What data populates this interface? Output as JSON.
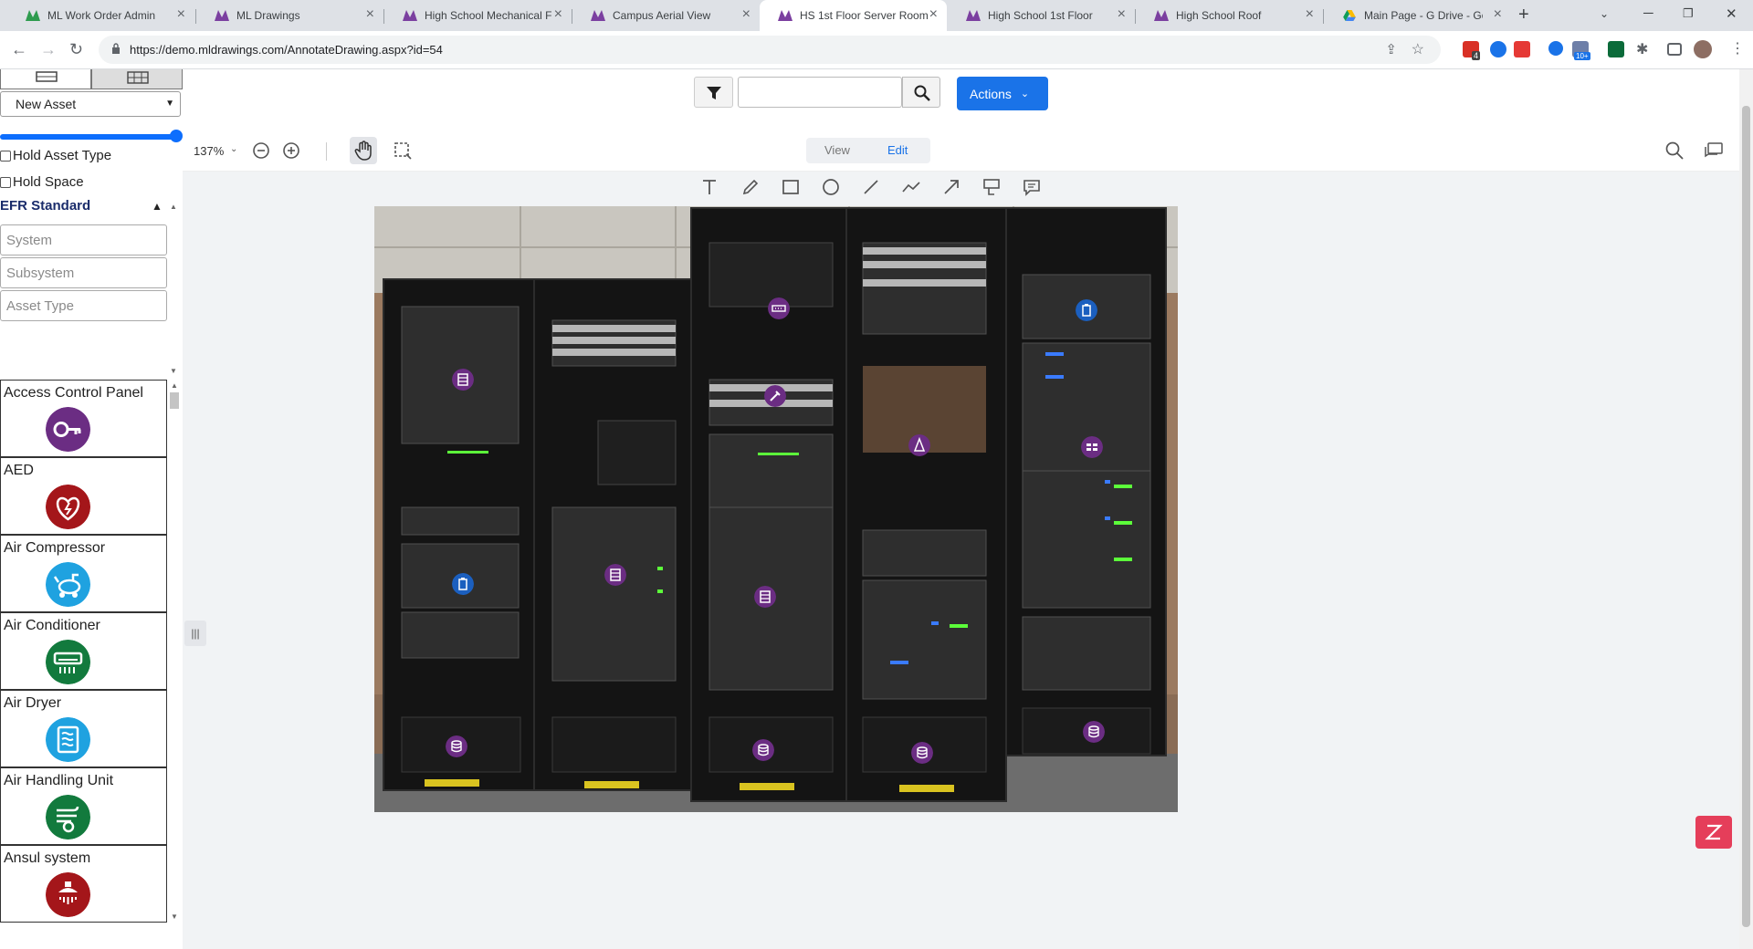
{
  "browser": {
    "tabs": [
      {
        "title": "ML Work Order Admin",
        "favicon": "ml-green-logo"
      },
      {
        "title": "ML Drawings",
        "favicon": "ml-purple-logo"
      },
      {
        "title": "High School Mechanical F",
        "favicon": "ml-purple-logo"
      },
      {
        "title": "Campus Aerial View",
        "favicon": "ml-purple-logo"
      },
      {
        "title": "HS 1st Floor Server Room",
        "favicon": "ml-purple-logo"
      },
      {
        "title": "High School 1st Floor",
        "favicon": "ml-purple-logo"
      },
      {
        "title": "High School Roof",
        "favicon": "ml-purple-logo"
      },
      {
        "title": "Main Page - G Drive - Goo",
        "favicon": "google-drive-logo"
      }
    ],
    "active_tab": 4,
    "new_tab": "+",
    "url": "https://demo.mldrawings.com/AnnotateDrawing.aspx?id=54",
    "ext_badges": {
      "b1": "4",
      "b2": "10+"
    }
  },
  "left_panel": {
    "new_asset_select": "New Asset",
    "hold_asset_type": "Hold Asset Type",
    "hold_space": "Hold Space",
    "efr_header": "EFR Standard",
    "system_placeholder": "System",
    "subsystem_placeholder": "Subsystem",
    "asset_type_placeholder": "Asset Type",
    "assets": [
      {
        "label": "Access Control Panel",
        "icon": "key-icon",
        "color": "#6b2d83"
      },
      {
        "label": "AED",
        "icon": "heart-icon",
        "color": "#a4161a"
      },
      {
        "label": "Air Compressor",
        "icon": "compressor-icon",
        "color": "#1fa2e0"
      },
      {
        "label": "Air Conditioner",
        "icon": "air-conditioner-icon",
        "color": "#127a3d"
      },
      {
        "label": "Air Dryer",
        "icon": "air-dryer-icon",
        "color": "#1fa2e0"
      },
      {
        "label": "Air Handling Unit",
        "icon": "fan-icon",
        "color": "#127a3d"
      },
      {
        "label": "Ansul system",
        "icon": "sprinkler-icon",
        "color": "#a4161a"
      }
    ]
  },
  "toolbar": {
    "actions_label": "Actions",
    "zoom_level": "137%",
    "view_label": "View",
    "edit_label": "Edit"
  },
  "colors": {
    "accent": "#1a73e8",
    "marker_purple": "#6b2d83",
    "marker_blue": "#1b5fbf"
  }
}
